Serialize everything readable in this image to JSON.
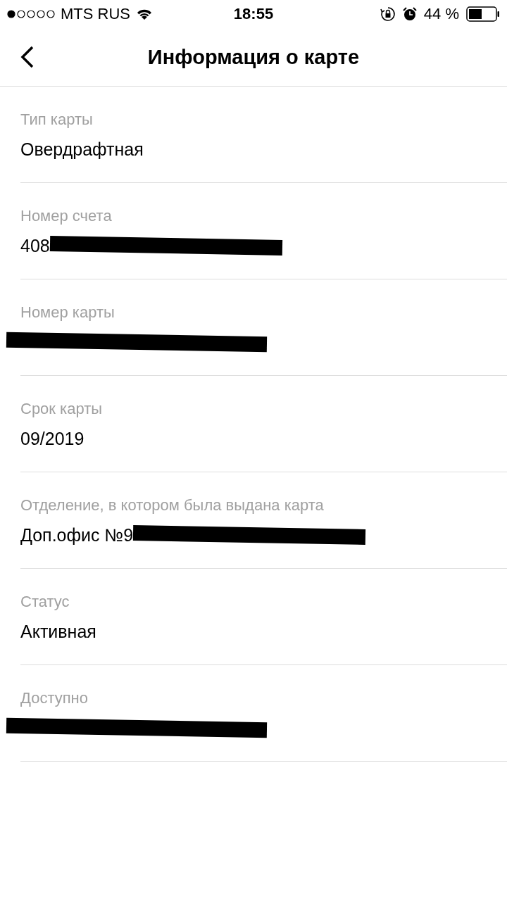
{
  "status_bar": {
    "carrier": "MTS RUS",
    "time": "18:55",
    "battery": "44 %"
  },
  "nav": {
    "title": "Информация о карте"
  },
  "fields": [
    {
      "label": "Тип карты",
      "value": "Овердрафтная"
    },
    {
      "label": "Номер счета",
      "value": "408",
      "redacted": true
    },
    {
      "label": "Номер карты",
      "redacted": true
    },
    {
      "label": "Срок карты",
      "value": "09/2019"
    },
    {
      "label": "Отделение, в котором была выдана карта",
      "value": "Доп.офис №9",
      "redacted": true
    },
    {
      "label": "Статус",
      "value": "Активная"
    },
    {
      "label": "Доступно",
      "redacted": true
    }
  ]
}
